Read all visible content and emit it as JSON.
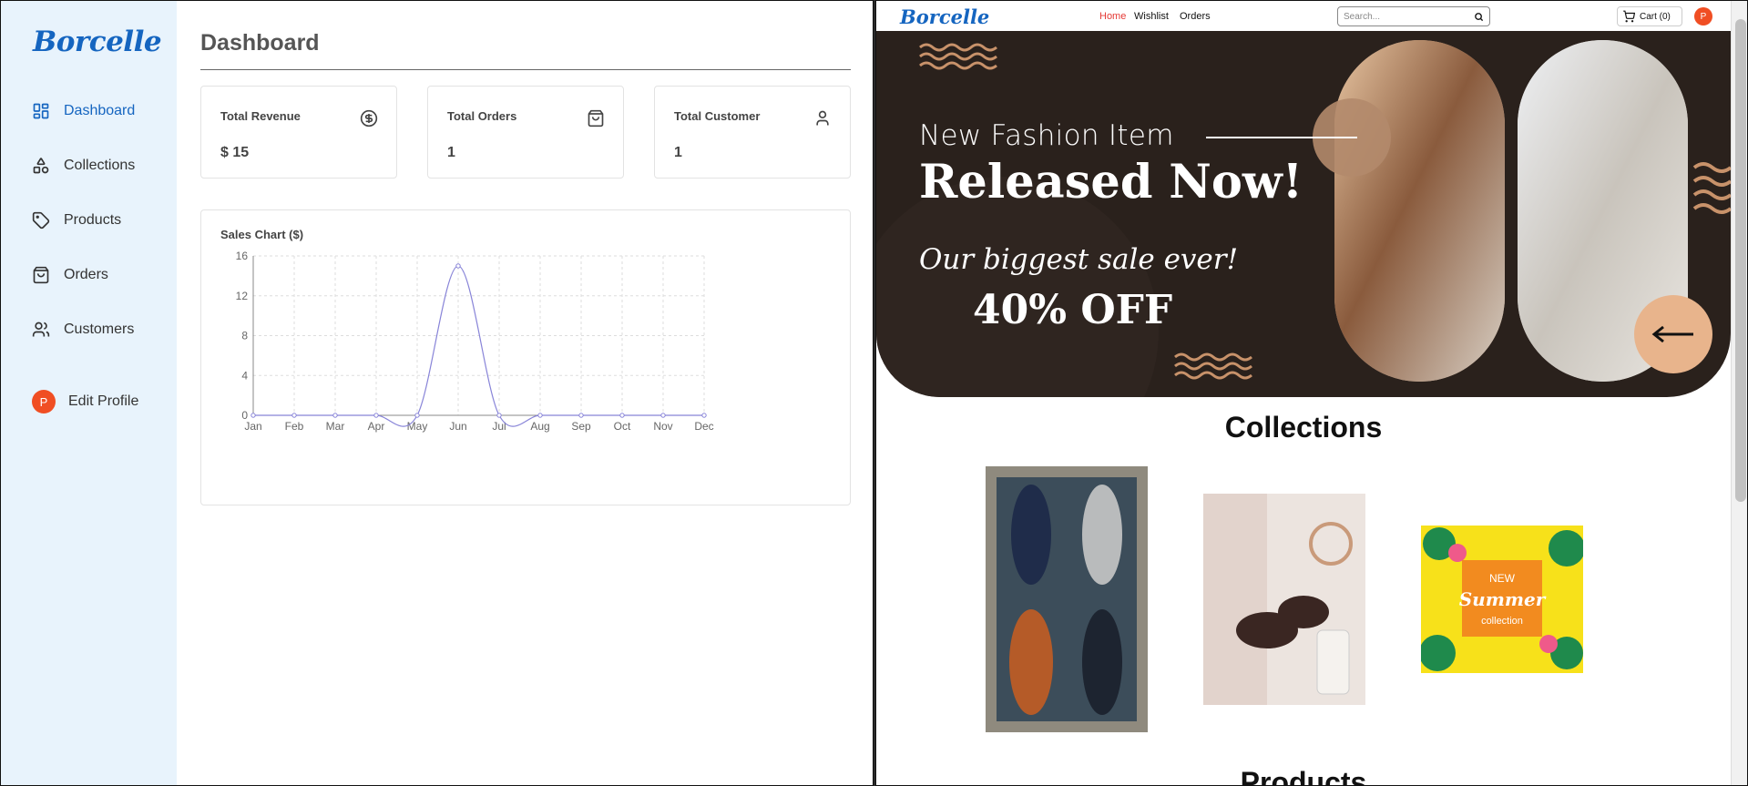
{
  "admin": {
    "logo": "Borcelle",
    "nav": [
      {
        "label": "Dashboard",
        "icon": "dashboard-icon",
        "active": true
      },
      {
        "label": "Collections",
        "icon": "shapes-icon"
      },
      {
        "label": "Products",
        "icon": "tag-icon"
      },
      {
        "label": "Orders",
        "icon": "shopping-bag-icon"
      },
      {
        "label": "Customers",
        "icon": "users-icon"
      }
    ],
    "edit_profile": {
      "avatar_letter": "P",
      "label": "Edit Profile"
    },
    "page_title": "Dashboard",
    "stats": [
      {
        "label": "Total Revenue",
        "value": "$ 15",
        "icon": "dollar-circle-icon"
      },
      {
        "label": "Total Orders",
        "value": "1",
        "icon": "shopping-bag-icon"
      },
      {
        "label": "Total Customer",
        "value": "1",
        "icon": "user-icon"
      }
    ],
    "colors": {
      "accent": "#1565c0",
      "sidebar_bg": "#e8f3fc",
      "line": "#8884d8",
      "avatar": "#f04e23"
    }
  },
  "chart_data": {
    "type": "line",
    "title": "Sales Chart ($)",
    "categories": [
      "Jan",
      "Feb",
      "Mar",
      "Apr",
      "May",
      "Jun",
      "Jul",
      "Aug",
      "Sep",
      "Oct",
      "Nov",
      "Dec"
    ],
    "series": [
      {
        "values": [
          0,
          0,
          0,
          0,
          0,
          15,
          0,
          0,
          0,
          0,
          0,
          0
        ]
      }
    ],
    "ylim": [
      0,
      16
    ],
    "yticks": [
      "0",
      "4",
      "8",
      "12",
      "16"
    ],
    "grid": true,
    "xlabel": "",
    "ylabel": ""
  },
  "store": {
    "logo": "Borcelle",
    "nav": [
      {
        "label": "Home",
        "active": true
      },
      {
        "label": "Wishlist"
      },
      {
        "label": "Orders"
      }
    ],
    "search": {
      "placeholder": "Search..."
    },
    "cart_label": "Cart (0)",
    "avatar_letter": "P",
    "hero": {
      "line1": "New Fashion Item",
      "line2": "Released Now!",
      "line3": "Our biggest sale ever!",
      "line4": "40% OFF",
      "bg": "#2a211c",
      "accent": "#e8b48c"
    },
    "collections_title": "Collections",
    "collections": [
      {
        "name": "shoes-collection-image"
      },
      {
        "name": "accessories-collection-image"
      },
      {
        "name": "summer-collection-image",
        "image_text": [
          "NEW",
          "Summer",
          "collection"
        ]
      }
    ],
    "products_title": "Products"
  }
}
